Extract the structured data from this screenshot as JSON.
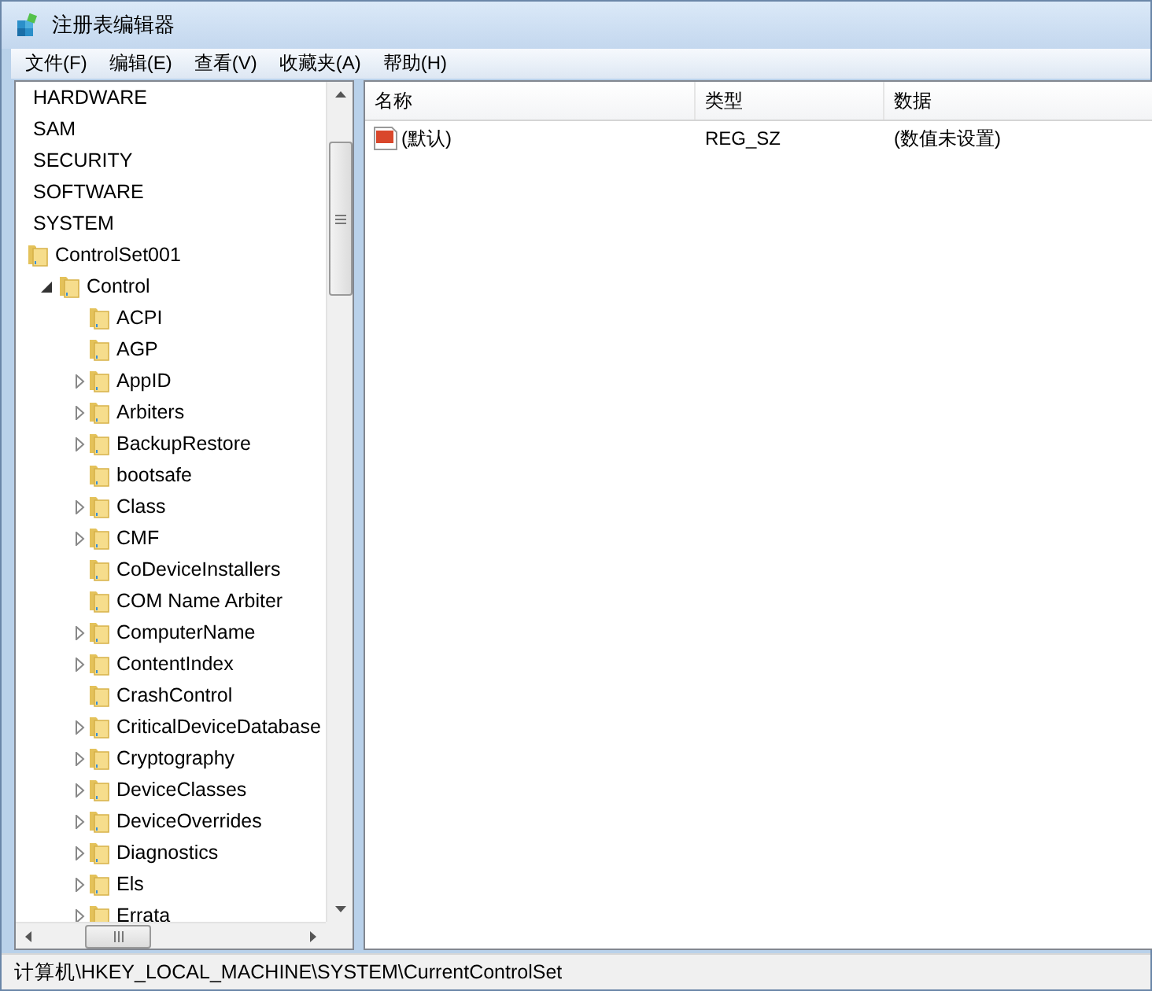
{
  "window": {
    "title": "注册表编辑器"
  },
  "menu": [
    "文件(F)",
    "编辑(E)",
    "查看(V)",
    "收藏夹(A)",
    "帮助(H)"
  ],
  "tree": [
    {
      "label": "HARDWARE"
    },
    {
      "label": "SAM"
    },
    {
      "label": "SECURITY"
    },
    {
      "label": "SOFTWARE"
    },
    {
      "label": "SYSTEM",
      "children": [
        {
          "label": "ControlSet001",
          "children": [
            {
              "label": "Control",
              "expanded": true,
              "children": [
                {
                  "label": "ACPI",
                  "expandable": false
                },
                {
                  "label": "AGP",
                  "expandable": false
                },
                {
                  "label": "AppID",
                  "expandable": true
                },
                {
                  "label": "Arbiters",
                  "expandable": true
                },
                {
                  "label": "BackupRestore",
                  "expandable": true
                },
                {
                  "label": "bootsafe",
                  "expandable": false
                },
                {
                  "label": "Class",
                  "expandable": true
                },
                {
                  "label": "CMF",
                  "expandable": true
                },
                {
                  "label": "CoDeviceInstallers",
                  "expandable": false
                },
                {
                  "label": "COM Name Arbiter",
                  "expandable": false
                },
                {
                  "label": "ComputerName",
                  "expandable": true
                },
                {
                  "label": "ContentIndex",
                  "expandable": true
                },
                {
                  "label": "CrashControl",
                  "expandable": false
                },
                {
                  "label": "CriticalDeviceDatabase",
                  "expandable": true
                },
                {
                  "label": "Cryptography",
                  "expandable": true
                },
                {
                  "label": "DeviceClasses",
                  "expandable": true
                },
                {
                  "label": "DeviceOverrides",
                  "expandable": true
                },
                {
                  "label": "Diagnostics",
                  "expandable": true
                },
                {
                  "label": "Els",
                  "expandable": true
                },
                {
                  "label": "Errata",
                  "expandable": true
                }
              ]
            }
          ]
        }
      ]
    }
  ],
  "table": {
    "columns": [
      "名称",
      "类型",
      "数据"
    ],
    "rows": [
      {
        "name": "(默认)",
        "type": "REG_SZ",
        "data": "(数值未设置)"
      }
    ]
  },
  "status_bar": "计算机\\HKEY_LOCAL_MACHINE\\SYSTEM\\CurrentControlSet"
}
